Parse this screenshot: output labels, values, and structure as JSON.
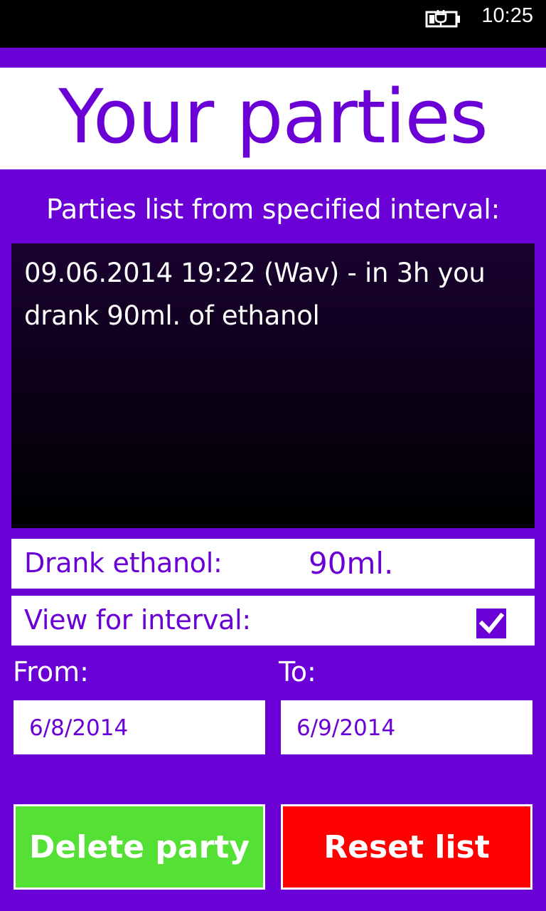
{
  "status_bar": {
    "time": "10:25",
    "battery_icon": "battery-charging-icon"
  },
  "header": {
    "title": "Your parties"
  },
  "list": {
    "heading": "Parties list from specified interval:",
    "items": [
      "09.06.2014 19:22 (Wav) - in 3h you drank 90ml. of ethanol"
    ]
  },
  "summary": {
    "drank_label": "Drank ethanol:",
    "drank_value": "90ml."
  },
  "interval": {
    "toggle_label": "View for interval:",
    "toggle_checked": true,
    "from_label": "From:",
    "to_label": "To:",
    "from_value": "6/8/2014",
    "to_value": "6/9/2014"
  },
  "buttons": {
    "delete_label": "Delete party",
    "reset_label": "Reset list"
  },
  "colors": {
    "accent": "#6b00d6",
    "delete_button": "#55e036",
    "reset_button": "#ff0000"
  }
}
